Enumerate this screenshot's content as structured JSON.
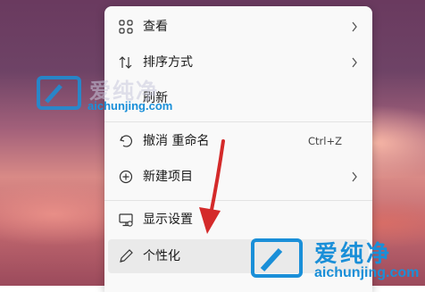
{
  "menu": {
    "items": [
      {
        "label": "查看",
        "icon": "grid-icon",
        "submenu": true
      },
      {
        "label": "排序方式",
        "icon": "sort-icon",
        "submenu": true
      },
      {
        "label": "刷新",
        "icon": "refresh-icon",
        "submenu": false
      },
      {
        "label": "撤消 重命名",
        "icon": "undo-icon",
        "shortcut": "Ctrl+Z"
      },
      {
        "label": "新建项目",
        "icon": "new-item-icon",
        "submenu": true
      },
      {
        "label": "显示设置",
        "icon": "display-icon",
        "submenu": false
      },
      {
        "label": "个性化",
        "icon": "brush-icon",
        "submenu": false
      }
    ]
  },
  "watermarks": [
    {
      "brand": "爱纯净",
      "url": "aichunjing.com"
    },
    {
      "brand": "爱纯净",
      "url": "aichunjing.com"
    }
  ],
  "colors": {
    "menu_bg": "#f9f9f9",
    "arrow": "#d42a2a",
    "watermark_blue": "#1a8fd8"
  }
}
